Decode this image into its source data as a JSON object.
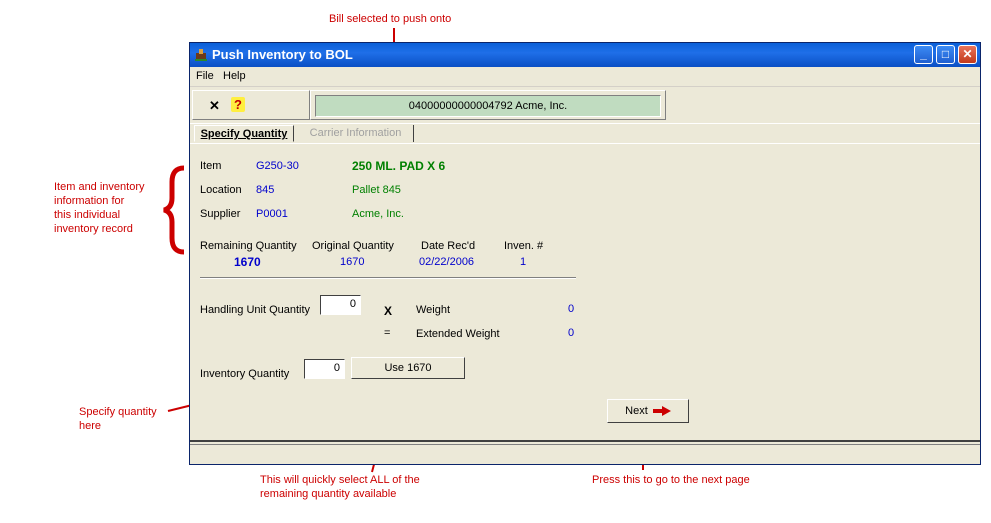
{
  "annotations": {
    "bill": "Bill selected to push onto",
    "item_info": [
      "Item and inventory",
      "information for",
      "this individual",
      "inventory record"
    ],
    "specify": [
      "Specify quantity",
      "here"
    ],
    "use_all": [
      "This will quickly select ALL of the",
      "remaining quantity available"
    ],
    "next": "Press this to go to the next page"
  },
  "window": {
    "title": "Push Inventory to BOL",
    "controls": {
      "minimize": "_",
      "maximize": "□",
      "close": "✕"
    }
  },
  "menu": [
    "File",
    "Help"
  ],
  "toolbar": {
    "close_glyph": "✕",
    "help_glyph": "?",
    "bill_text": "04000000000004792  Acme, Inc."
  },
  "tabs": {
    "active": "Specify Quantity",
    "inactive": "Carrier Information"
  },
  "record": {
    "item_label": "Item",
    "item_code": "G250-30",
    "item_desc": "250 ML.   PAD X 6",
    "location_label": "Location",
    "location_code": "845",
    "location_desc": "Pallet 845",
    "supplier_label": "Supplier",
    "supplier_code": "P0001",
    "supplier_desc": "Acme, Inc.",
    "remaining_label": "Remaining Quantity",
    "remaining_value": "1670",
    "original_label": "Original Quantity",
    "original_value": "1670",
    "date_label": "Date Rec'd",
    "date_value": "02/22/2006",
    "inven_label": "Inven. #",
    "inven_value": "1"
  },
  "quantity": {
    "hu_label": "Handling Unit Quantity",
    "hu_value": "0",
    "times": "X",
    "equals": "=",
    "weight_label": "Weight",
    "weight_value": "0",
    "ext_weight_label": "Extended Weight",
    "ext_weight_value": "0",
    "inv_label": "Inventory Quantity",
    "inv_value": "0",
    "use_button": "Use 1670",
    "next_button": "Next"
  },
  "colors": {
    "annotation": "#cc0000",
    "bill_field": "#c0dcc0",
    "value_blue": "#0000cc",
    "value_green": "#008000"
  }
}
